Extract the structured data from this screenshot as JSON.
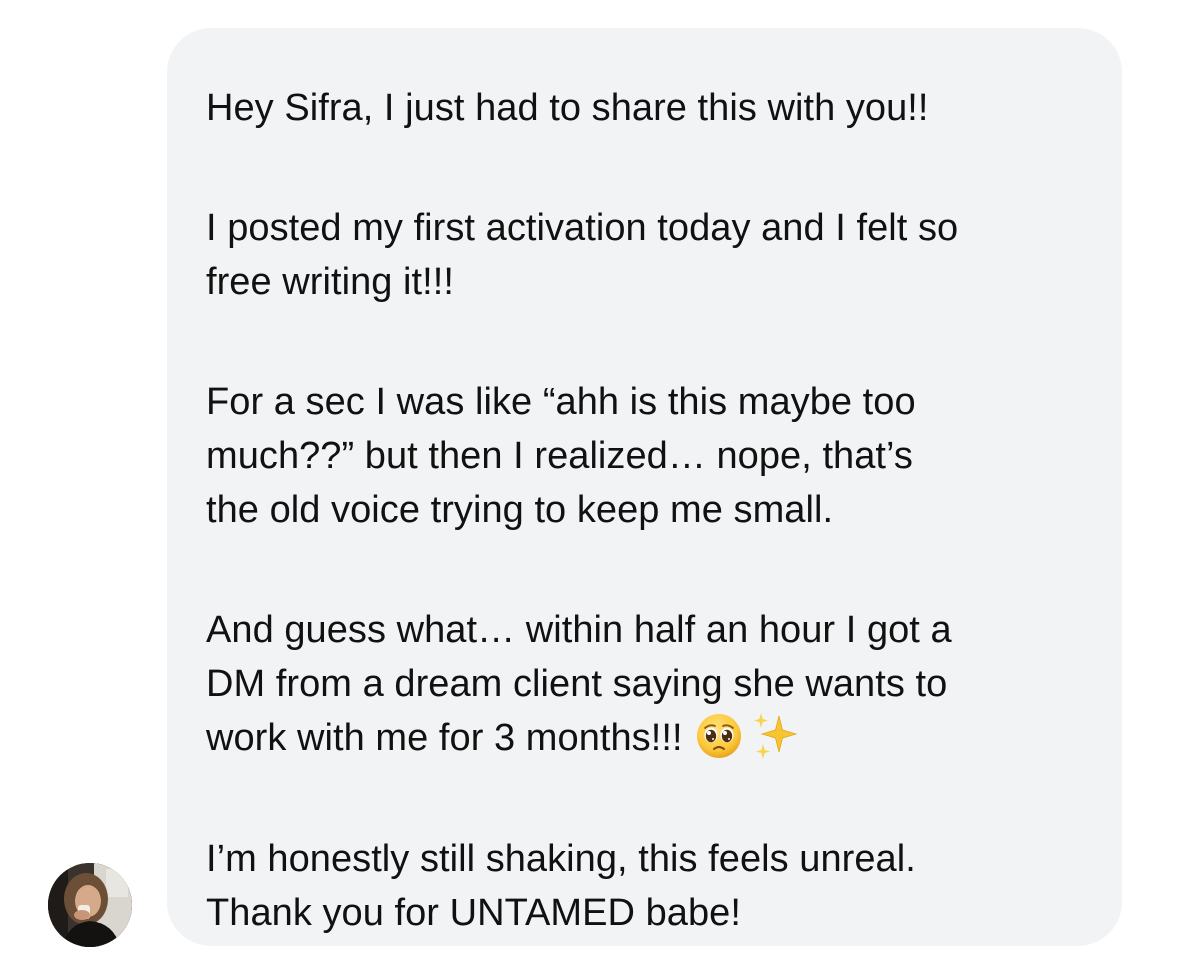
{
  "chat": {
    "sender": {
      "avatar_icon": "profile-photo"
    },
    "message": {
      "paragraphs": [
        {
          "lines": [
            "Hey Sifra, I just had to share this with you!!"
          ]
        },
        {
          "lines": [
            "I posted my first activation today and I felt so",
            "free writing it!!!"
          ]
        },
        {
          "lines": [
            "For a sec I was like “ahh is this maybe too",
            "much??” but then I realized… nope, that’s",
            "the old voice trying to keep me small."
          ]
        },
        {
          "lines": [
            "And guess what… within half an hour I got a",
            "DM from a dream client saying she wants to",
            "work with me for 3 months!!!"
          ],
          "emojis": [
            "pleading-face-emoji",
            "sparkles-emoji"
          ]
        },
        {
          "lines": [
            "I’m honestly still shaking, this feels unreal.",
            "Thank you for UNTAMED babe!"
          ]
        }
      ]
    },
    "colors": {
      "bubble": "#f2f3f5",
      "text": "#111111"
    }
  }
}
